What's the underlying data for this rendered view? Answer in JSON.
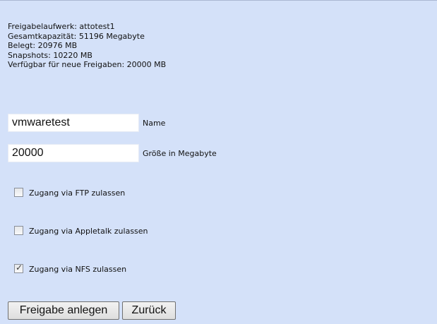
{
  "info": {
    "lines": [
      "Freigabelaufwerk: attotest1",
      "Gesamtkapazität: 51196 Megabyte",
      "Belegt: 20976 MB",
      "Snapshots: 10220 MB",
      "Verfügbar für neue Freigaben: 20000 MB"
    ]
  },
  "form": {
    "name": {
      "value": "vmwaretest",
      "label": "Name"
    },
    "size": {
      "value": "20000",
      "label": "Größe in Megabyte"
    }
  },
  "options": [
    {
      "label": "Zugang via FTP zulassen",
      "checked": false
    },
    {
      "label": "Zugang via Appletalk zulassen",
      "checked": false
    },
    {
      "label": "Zugang via NFS zulassen",
      "checked": true
    }
  ],
  "buttons": {
    "create": "Freigabe anlegen",
    "back": "Zurück"
  }
}
